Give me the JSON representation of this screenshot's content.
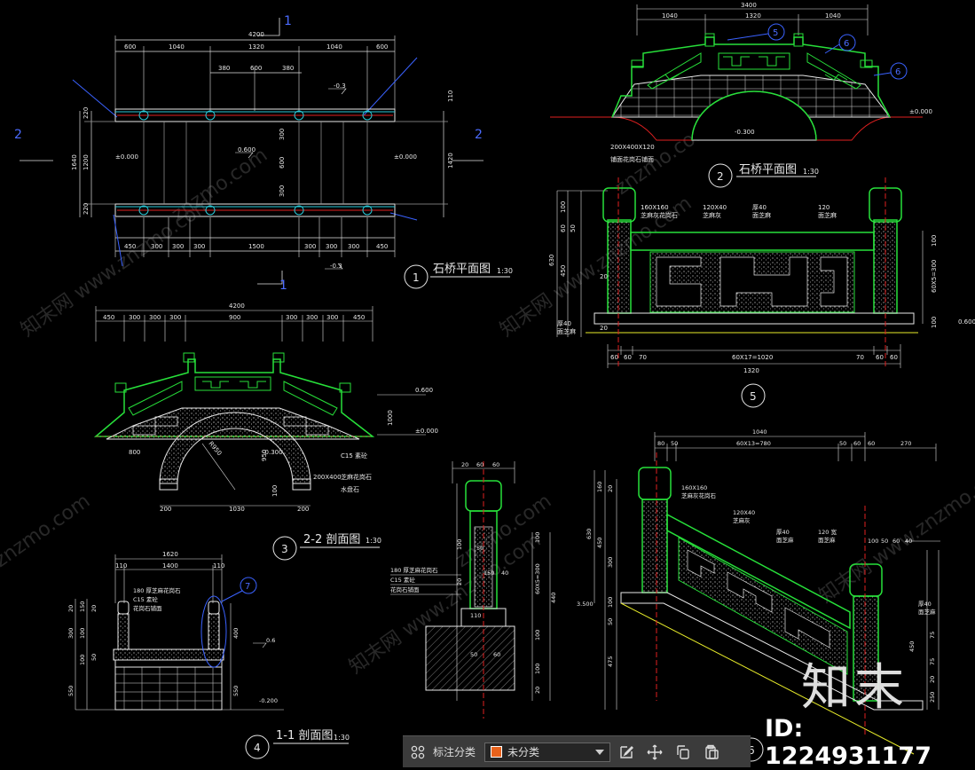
{
  "drawing": {
    "view1": {
      "num": "1",
      "title": "石桥平面图",
      "scale": "1:30",
      "dims_top": [
        "4200",
        "600",
        "1040",
        "1320",
        "1040",
        "600",
        "380",
        "600",
        "380"
      ],
      "dims_bottom": [
        "450",
        "300",
        "300",
        "300",
        "1500",
        "300",
        "300",
        "300",
        "450"
      ],
      "dims_right": [
        "1420",
        "110"
      ],
      "dims_left": [
        "220",
        "1200",
        "220",
        "1640"
      ],
      "labels": [
        "-0.3",
        "0.600",
        "±0.000",
        "±0.000",
        "300",
        "600",
        "300",
        "-0.3"
      ],
      "section_marks": [
        "2",
        "2",
        "1",
        "1"
      ]
    },
    "view2": {
      "num": "2",
      "title": "石桥平面图",
      "scale": "1:30",
      "dims_top": [
        "3400",
        "1040",
        "1320",
        "1040"
      ],
      "labels": [
        "±0.000",
        "-0.300",
        "200X400X120",
        "铺面花岗石铺面"
      ],
      "callouts": [
        "5",
        "6",
        "6"
      ]
    },
    "view5": {
      "num": "5",
      "dims_bottom": [
        "60",
        "60",
        "70",
        "60X17=1020",
        "70",
        "60",
        "60"
      ],
      "total": "1320",
      "dims_left": [
        "630",
        "100",
        "60",
        "50",
        "450",
        "20",
        "20"
      ],
      "dims_right": [
        "100",
        "60X5=300",
        "100"
      ],
      "labels": [
        "160X160",
        "芝麻灰花岗石",
        "120X40",
        "芝麻灰",
        "厚40",
        "面芝麻",
        "120",
        "面芝麻",
        "厚40",
        "面芝麻",
        "0.600"
      ]
    },
    "view3": {
      "num": "3",
      "title": "2-2 剖面图",
      "scale": "1:30",
      "dims_top": [
        "4200",
        "450",
        "300",
        "300",
        "300",
        "900",
        "300",
        "300",
        "300",
        "450"
      ],
      "dims_bottom": [
        "200",
        "1030",
        "200"
      ],
      "labels": [
        "0.600",
        "±0.000",
        "1000",
        "950",
        "100",
        "-0.300",
        "C15 素砼",
        "200X400",
        "芝麻花岗石",
        "水盘石",
        "800",
        "R950"
      ]
    },
    "view4": {
      "num": "4",
      "title": "1-1 剖面图",
      "scale": "1:30",
      "dims_top": [
        "1620",
        "110",
        "1400",
        "110"
      ],
      "dims_left": [
        "20",
        "150",
        "20",
        "300",
        "100",
        "50",
        "100",
        "550"
      ],
      "dims_right": [
        "400",
        "550",
        "0.6",
        "-0.200"
      ],
      "labels": [
        "180 厚芝麻花岗石",
        "C15 素砼",
        "花岗石铺面"
      ],
      "callout": "7"
    },
    "view6": {
      "num": "6",
      "dims_top": [
        "1040",
        "80",
        "50",
        "60X13=780",
        "50",
        "60",
        "60",
        "270"
      ],
      "dims_left": [
        "160",
        "20",
        "630",
        "450",
        "300",
        "100",
        "475",
        "50"
      ],
      "dims_right": [
        "100",
        "50",
        "60",
        "40",
        "75",
        "75",
        "20",
        "250"
      ],
      "labels": [
        "160X160",
        "芝麻灰花岗石",
        "120X40",
        "芝麻灰",
        "厚40",
        "面芝麻",
        "120 宽",
        "面芝麻",
        "厚40",
        "面芝麻",
        "3.500",
        "450"
      ]
    },
    "view7": {
      "dims_top": [
        "20",
        "60",
        "60"
      ],
      "dims_left": [
        "440",
        "100",
        "60X5=300",
        "100"
      ],
      "dims_right": [
        "100",
        "20",
        "100",
        "20"
      ],
      "labels": [
        "180 厚芝麻花岗石",
        "C15 素砼",
        "花岗石铺面",
        "50",
        "150",
        "40",
        "50",
        "110",
        "60"
      ]
    },
    "watermark": {
      "site": "znzmo.com",
      "cn": "知末网 www.znzmo.com"
    }
  },
  "toolbar": {
    "grid_icon": "grid-icon",
    "category_label": "标注分类",
    "category_value": "未分类",
    "category_color": "#e8621c",
    "edit_icon": "edit-icon",
    "move_icon": "move-icon",
    "copy_icon": "copy-icon",
    "paste_icon": "paste-icon"
  },
  "watermark_brand": {
    "logo": "知末",
    "id": "ID: 1224931177"
  },
  "colors": {
    "bg": "#000000",
    "green": "#27e03a",
    "white": "#e8e8e8",
    "dim": "#3a62ff",
    "red": "#e02020",
    "cyan": "#29c9d8"
  }
}
